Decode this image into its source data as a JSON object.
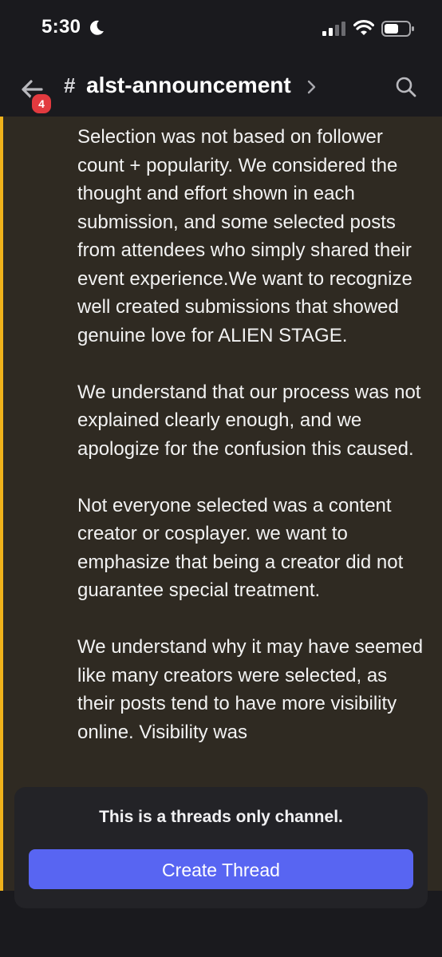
{
  "status_bar": {
    "time": "5:30"
  },
  "header": {
    "back_badge_count": "4",
    "channel_hash": "#",
    "channel_name": "alst-announcement"
  },
  "message": {
    "paragraphs": [
      "Selection was not based on follower count + popularity. We considered the thought and effort shown in each submission, and some selected posts from attendees who simply shared their event experience.We want to recognize well created submissions that showed genuine love for ALIEN STAGE.",
      "We understand that our process was not explained clearly enough, and we apologize for the confusion this caused.",
      "Not everyone selected was a content creator or cosplayer. we want to emphasize that being a creator did not guarantee special treatment.",
      "We understand why it may have seemed like many creators were selected, as their posts tend to have more visibility online. Visibility was"
    ]
  },
  "thread_panel": {
    "notice": "This is a threads only channel.",
    "button_label": "Create Thread"
  },
  "colors": {
    "highlight": "#efb21b",
    "accent_button": "#5865f2",
    "badge": "#e23a3f",
    "message_bg": "#2f2a22"
  },
  "icons": [
    "moon-icon",
    "signal-icon",
    "wifi-icon",
    "battery-icon",
    "back-arrow-icon",
    "chevron-right-icon",
    "search-icon"
  ]
}
